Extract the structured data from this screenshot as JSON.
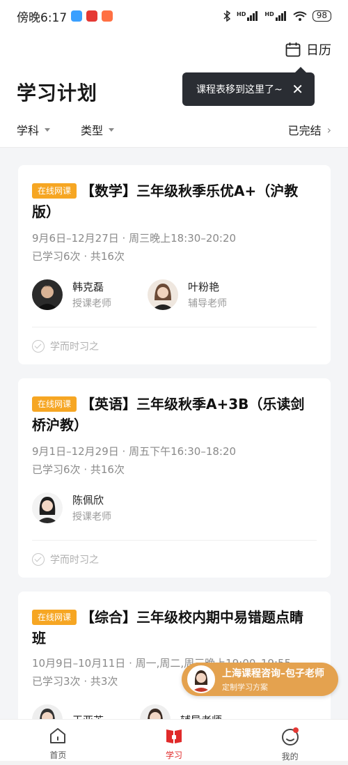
{
  "status": {
    "time": "傍晚6:17",
    "battery": "98",
    "hd1": "HD",
    "hd2": "HD",
    "apps": [
      {
        "color": "#3aa0ff"
      },
      {
        "color": "#e53935"
      },
      {
        "color": "#ff7043"
      }
    ]
  },
  "header": {
    "calendar_label": "日历",
    "title": "学习计划",
    "tooltip": "课程表移到这里了~"
  },
  "filters": {
    "subject": "学科",
    "type": "类型",
    "completed": "已完结"
  },
  "badge_label": "在线网课",
  "courses": [
    {
      "title": "【数学】三年级秋季乐优A+（沪教版）",
      "dates": "9月6日–12月27日",
      "schedule": "周三晚上18:30–20:20",
      "progress": "已学习6次",
      "total": "共16次",
      "teachers": [
        {
          "name": "韩克磊",
          "role": "授课老师"
        },
        {
          "name": "叶粉艳",
          "role": "辅导老师"
        }
      ],
      "footer": "学而时习之"
    },
    {
      "title": "【英语】三年级秋季A+3B（乐读剑桥沪教）",
      "dates": "9月1日–12月29日",
      "schedule": "周五下午16:30–18:20",
      "progress": "已学习6次",
      "total": "共16次",
      "teachers": [
        {
          "name": "陈佩欣",
          "role": "授课老师"
        }
      ],
      "footer": "学而时习之"
    },
    {
      "title": "【综合】三年级校内期中易错题点睛班",
      "dates": "10月9日–10月11日",
      "schedule": "周一,周二,周三晚上19:00–19:55",
      "progress": "已学习3次",
      "total": "共3次",
      "teachers": [
        {
          "name": "王亚芳",
          "role": ""
        },
        {
          "name": "辅导老师",
          "role": ""
        }
      ]
    }
  ],
  "consult": {
    "title": "上海课程咨询–包子老师",
    "subtitle": "定制学习方案"
  },
  "tabs": [
    {
      "label": "首页"
    },
    {
      "label": "学习"
    },
    {
      "label": "我的"
    }
  ],
  "colors": {
    "accent_red": "#e02a2a",
    "badge_orange": "#f6a623",
    "consult_orange": "#e4a24f"
  }
}
